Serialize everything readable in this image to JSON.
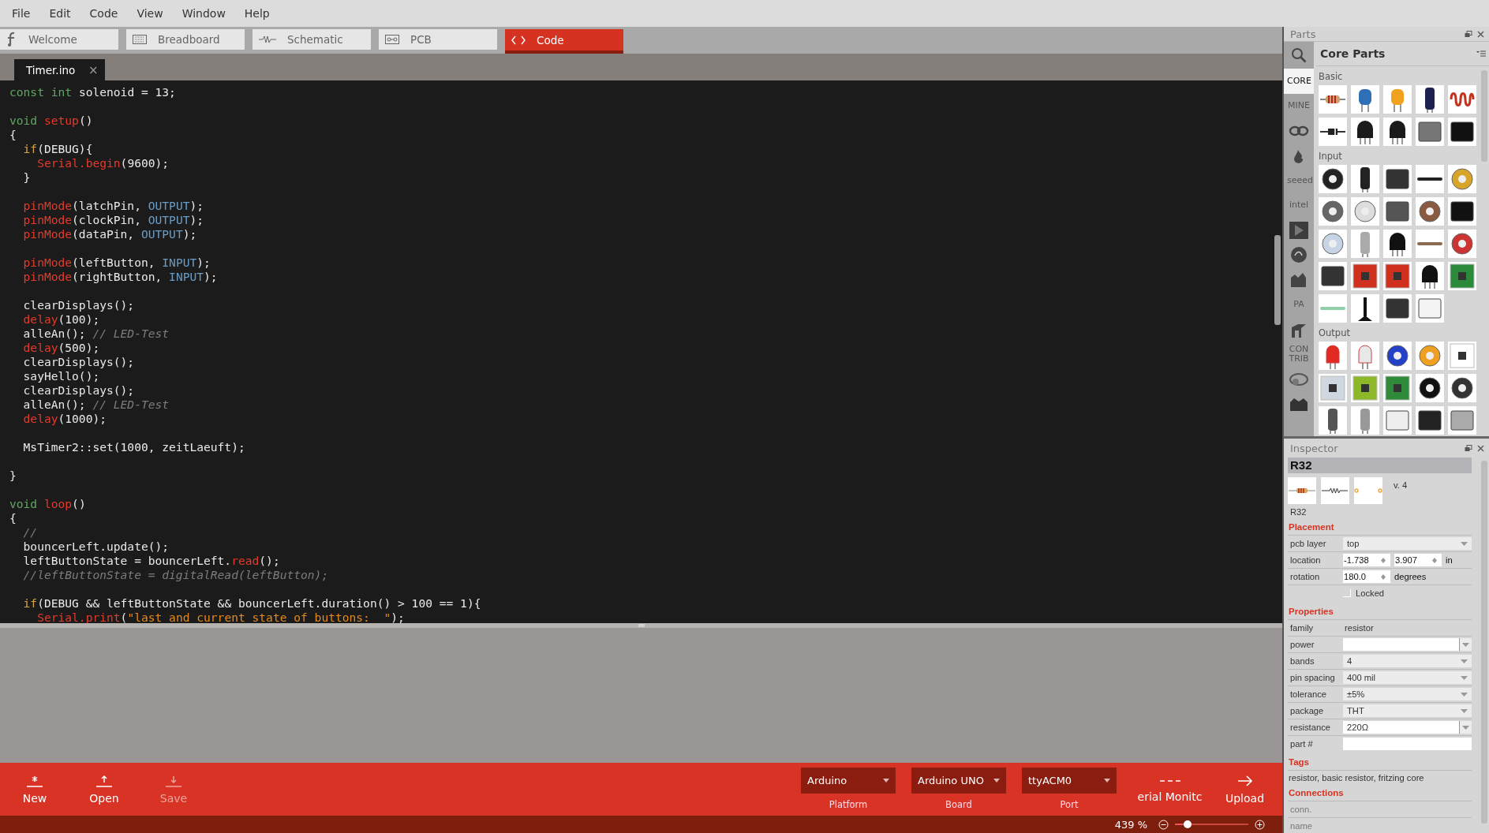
{
  "menu": [
    "File",
    "Edit",
    "Code",
    "View",
    "Window",
    "Help"
  ],
  "view_tabs": [
    {
      "label": "Welcome",
      "kind": "welcome",
      "selected": false
    },
    {
      "label": "Breadboard",
      "kind": "breadboard",
      "selected": false
    },
    {
      "label": "Schematic",
      "kind": "schematic",
      "selected": false
    },
    {
      "label": "PCB",
      "kind": "pcb",
      "selected": false
    },
    {
      "label": "Code",
      "kind": "code",
      "selected": true
    }
  ],
  "file_tabs": [
    {
      "label": "Timer.ino",
      "close": "×",
      "selected": true
    }
  ],
  "code": {
    "lines": [
      {
        "kind": "code",
        "tokens": [
          {
            "kind": "keyword",
            "text": "const"
          },
          {
            "kind": "keyword",
            "text": " int"
          },
          {
            "kind": "plain",
            "text": " solenoid = 13;"
          }
        ]
      },
      {
        "kind": "blank"
      },
      {
        "kind": "code",
        "tokens": [
          {
            "kind": "keyword",
            "text": "void"
          },
          {
            "kind": "function",
            "text": " setup"
          },
          {
            "kind": "plain",
            "text": "()"
          }
        ]
      },
      {
        "kind": "code",
        "tokens": [
          {
            "kind": "plain",
            "text": "{"
          }
        ]
      },
      {
        "kind": "code",
        "tokens": [
          {
            "kind": "control",
            "text": "  if"
          },
          {
            "kind": "plain",
            "text": "(DEBUG){"
          }
        ]
      },
      {
        "kind": "code",
        "tokens": [
          {
            "kind": "function",
            "text": "    Serial.begin"
          },
          {
            "kind": "plain",
            "text": "(9600);"
          }
        ]
      },
      {
        "kind": "code",
        "tokens": [
          {
            "kind": "plain",
            "text": "  }"
          }
        ]
      },
      {
        "kind": "blank"
      },
      {
        "kind": "code",
        "tokens": [
          {
            "kind": "function",
            "text": "  pinMode"
          },
          {
            "kind": "plain",
            "text": "(latchPin, "
          },
          {
            "kind": "constant",
            "text": "OUTPUT"
          },
          {
            "kind": "plain",
            "text": ");"
          }
        ]
      },
      {
        "kind": "code",
        "tokens": [
          {
            "kind": "function",
            "text": "  pinMode"
          },
          {
            "kind": "plain",
            "text": "(clockPin, "
          },
          {
            "kind": "constant",
            "text": "OUTPUT"
          },
          {
            "kind": "plain",
            "text": ");"
          }
        ]
      },
      {
        "kind": "code",
        "tokens": [
          {
            "kind": "function",
            "text": "  pinMode"
          },
          {
            "kind": "plain",
            "text": "(dataPin, "
          },
          {
            "kind": "constant",
            "text": "OUTPUT"
          },
          {
            "kind": "plain",
            "text": ");"
          }
        ]
      },
      {
        "kind": "blank"
      },
      {
        "kind": "code",
        "tokens": [
          {
            "kind": "function",
            "text": "  pinMode"
          },
          {
            "kind": "plain",
            "text": "(leftButton, "
          },
          {
            "kind": "constant",
            "text": "INPUT"
          },
          {
            "kind": "plain",
            "text": ");"
          }
        ]
      },
      {
        "kind": "code",
        "tokens": [
          {
            "kind": "function",
            "text": "  pinMode"
          },
          {
            "kind": "plain",
            "text": "(rightButton, "
          },
          {
            "kind": "constant",
            "text": "INPUT"
          },
          {
            "kind": "plain",
            "text": ");"
          }
        ]
      },
      {
        "kind": "blank"
      },
      {
        "kind": "code",
        "tokens": [
          {
            "kind": "plain",
            "text": "  clearDisplays();"
          }
        ]
      },
      {
        "kind": "code",
        "tokens": [
          {
            "kind": "function",
            "text": "  delay"
          },
          {
            "kind": "plain",
            "text": "(100);"
          }
        ]
      },
      {
        "kind": "code",
        "tokens": [
          {
            "kind": "plain",
            "text": "  alleAn(); "
          },
          {
            "kind": "comment",
            "text": "// LED-Test"
          }
        ]
      },
      {
        "kind": "code",
        "tokens": [
          {
            "kind": "function",
            "text": "  delay"
          },
          {
            "kind": "plain",
            "text": "(500);"
          }
        ]
      },
      {
        "kind": "code",
        "tokens": [
          {
            "kind": "plain",
            "text": "  clearDisplays();"
          }
        ]
      },
      {
        "kind": "code",
        "tokens": [
          {
            "kind": "plain",
            "text": "  sayHello();"
          }
        ]
      },
      {
        "kind": "code",
        "tokens": [
          {
            "kind": "plain",
            "text": "  clearDisplays();"
          }
        ]
      },
      {
        "kind": "code",
        "tokens": [
          {
            "kind": "plain",
            "text": "  alleAn(); "
          },
          {
            "kind": "comment",
            "text": "// LED-Test"
          }
        ]
      },
      {
        "kind": "code",
        "tokens": [
          {
            "kind": "function",
            "text": "  delay"
          },
          {
            "kind": "plain",
            "text": "(1000);"
          }
        ]
      },
      {
        "kind": "blank"
      },
      {
        "kind": "code",
        "tokens": [
          {
            "kind": "plain",
            "text": "  MsTimer2::set(1000, zeitLaeuft);"
          }
        ]
      },
      {
        "kind": "blank"
      },
      {
        "kind": "code",
        "tokens": [
          {
            "kind": "plain",
            "text": "}"
          }
        ]
      },
      {
        "kind": "blank"
      },
      {
        "kind": "code",
        "tokens": [
          {
            "kind": "keyword",
            "text": "void"
          },
          {
            "kind": "function",
            "text": " loop"
          },
          {
            "kind": "plain",
            "text": "()"
          }
        ]
      },
      {
        "kind": "code",
        "tokens": [
          {
            "kind": "plain",
            "text": "{"
          }
        ]
      },
      {
        "kind": "code",
        "tokens": [
          {
            "kind": "comment",
            "text": "  //"
          }
        ]
      },
      {
        "kind": "code",
        "tokens": [
          {
            "kind": "plain",
            "text": "  bouncerLeft.update();"
          }
        ]
      },
      {
        "kind": "code",
        "tokens": [
          {
            "kind": "plain",
            "text": "  leftButtonState = bouncerLeft."
          },
          {
            "kind": "function",
            "text": "read"
          },
          {
            "kind": "plain",
            "text": "();"
          }
        ]
      },
      {
        "kind": "code",
        "tokens": [
          {
            "kind": "comment",
            "text": "  //leftButtonState = digitalRead(leftButton);"
          }
        ]
      },
      {
        "kind": "blank"
      },
      {
        "kind": "code",
        "tokens": [
          {
            "kind": "control",
            "text": "  if"
          },
          {
            "kind": "plain",
            "text": "(DEBUG && leftButtonState && bouncerLeft.duration() > 100 == 1){"
          }
        ]
      },
      {
        "kind": "code",
        "tokens": [
          {
            "kind": "function",
            "text": "    Serial.print"
          },
          {
            "kind": "plain",
            "text": "("
          },
          {
            "kind": "string",
            "text": "\"last and current state of buttons:  \""
          },
          {
            "kind": "plain",
            "text": ");"
          }
        ]
      }
    ]
  },
  "bottom_toolbar": {
    "buttons": [
      {
        "label": "New",
        "kind": "new",
        "disabled": false
      },
      {
        "label": "Open",
        "kind": "open",
        "disabled": false
      },
      {
        "label": "Save",
        "kind": "save",
        "disabled": true
      }
    ],
    "selectors": [
      {
        "value": "Arduino",
        "caption": "Platform"
      },
      {
        "value": "Arduino UNO",
        "caption": "Board"
      },
      {
        "value": "ttyACM0",
        "caption": "Port"
      }
    ],
    "actions": [
      {
        "label": "erial Monitc",
        "kind": "monitor"
      },
      {
        "label": "Upload",
        "kind": "upload"
      }
    ]
  },
  "status_bar": {
    "zoom": "439 %",
    "zoom_slider": {
      "level": 0.17
    }
  },
  "parts": {
    "title": "Parts",
    "heading": "Core Parts",
    "bins": [
      {
        "kind": "text",
        "label": "CORE",
        "selected": true
      },
      {
        "kind": "text",
        "label": "MINE",
        "selected": false
      },
      {
        "kind": "infinity",
        "selected": false
      },
      {
        "kind": "flame",
        "selected": false
      },
      {
        "kind": "text",
        "label": "seeed",
        "selected": false
      },
      {
        "kind": "text",
        "label": "intel",
        "selected": false
      },
      {
        "kind": "play",
        "selected": false
      },
      {
        "kind": "circle",
        "selected": false
      },
      {
        "kind": "blob",
        "selected": false
      },
      {
        "kind": "text",
        "label": "PA",
        "selected": false
      },
      {
        "kind": "animal",
        "selected": false
      },
      {
        "kind": "text",
        "label": "CON TRIB",
        "selected": false
      },
      {
        "kind": "snail",
        "selected": false
      },
      {
        "kind": "crown",
        "selected": false
      }
    ],
    "sections": [
      {
        "title": "Basic"
      },
      {
        "title": "Input"
      },
      {
        "title": "Output"
      }
    ]
  },
  "inspector": {
    "title": "Inspector",
    "part": "R32",
    "version": "v. 4",
    "caption": "R32",
    "sections": [
      {
        "title": "Placement",
        "rows": [
          {
            "kind": "select",
            "label": "pcb layer",
            "value": "top"
          },
          {
            "kind": "spin",
            "label": "location",
            "values": [
              "-1.738",
              "3.907"
            ],
            "unit": "in"
          },
          {
            "kind": "spin",
            "label": "rotation",
            "values": [
              "180.0"
            ],
            "unit": "degrees"
          },
          {
            "kind": "checkbox",
            "label": "Locked",
            "checked": false
          }
        ]
      },
      {
        "title": "Properties",
        "rows": [
          {
            "kind": "text",
            "label": "family",
            "value": "resistor"
          },
          {
            "kind": "combo",
            "label": "power"
          },
          {
            "kind": "select",
            "label": "bands",
            "value": "4"
          },
          {
            "kind": "select",
            "label": "pin spacing",
            "value": "400 mil"
          },
          {
            "kind": "select",
            "label": "tolerance",
            "value": "±5%"
          },
          {
            "kind": "select",
            "label": "package",
            "value": "THT"
          },
          {
            "kind": "combo",
            "label": "resistance",
            "value": "220Ω"
          },
          {
            "kind": "field",
            "label": "part #"
          }
        ]
      },
      {
        "title": "Tags",
        "text": "resistor, basic resistor, fritzing core"
      },
      {
        "title": "Connections",
        "rows": [
          {
            "kind": "label",
            "label": "conn."
          },
          {
            "kind": "label",
            "label": "name"
          }
        ]
      }
    ]
  }
}
